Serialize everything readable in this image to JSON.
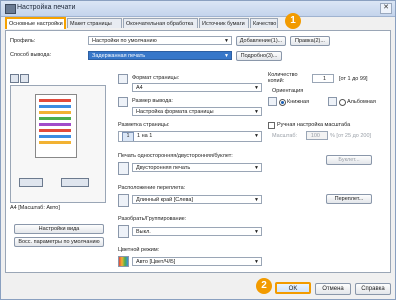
{
  "window": {
    "title": "Настройка печати",
    "close": "✕"
  },
  "tabs": [
    {
      "label": "Основные настройки"
    },
    {
      "label": "Макет страницы"
    },
    {
      "label": "Окончательная обработка"
    },
    {
      "label": "Источник бумаги"
    },
    {
      "label": "Качество"
    }
  ],
  "badges": {
    "one": "1",
    "two": "2"
  },
  "profile": {
    "label": "Профиль:",
    "value": "Настройки по умолчанию",
    "add": "Добавление(1)...",
    "edit": "Правка(2)..."
  },
  "output": {
    "label": "Способ вывода:",
    "value": "Задержанная печать",
    "details": "Подробно(3)..."
  },
  "preview": {
    "caption": "A4 [Масштаб: Авто]",
    "view_settings": "Настройки вида",
    "restore": "Восс. параметры по умолчанию"
  },
  "page_format": {
    "label": "Формат страницы:",
    "value": "A4"
  },
  "output_size": {
    "label": "Размер вывода:",
    "value": "Настройка формата страницы"
  },
  "copies": {
    "label": "Количество копий:",
    "value": "1",
    "range": "[от 1 до 99]"
  },
  "orientation": {
    "label": "Ориентация",
    "portrait": "Книжная",
    "landscape": "Альбомная"
  },
  "layout": {
    "label": "Разметка страницы:",
    "value": "1 на 1"
  },
  "manual_scale": {
    "label": "Ручная настройка масштаба",
    "scale_label": "Масштаб:",
    "value": "100",
    "range": "% [от 25 до 200]"
  },
  "booklet": {
    "label": "Буклет..."
  },
  "duplex": {
    "label": "Печать односторонняя/двусторонняя/буклет:",
    "value": "Двусторонняя печать"
  },
  "binding": {
    "label": "Расположение переплета:",
    "value": "Длинный край [Слева]",
    "gutter": "Переплет..."
  },
  "collate": {
    "label": "Разобрать/Группирование:",
    "value": "Выкл."
  },
  "color_mode": {
    "label": "Цветной режим:",
    "value": "Авто [Цвет/Ч/Б]"
  },
  "footer": {
    "ok": "OK",
    "cancel": "Отмена",
    "help": "Справка"
  }
}
